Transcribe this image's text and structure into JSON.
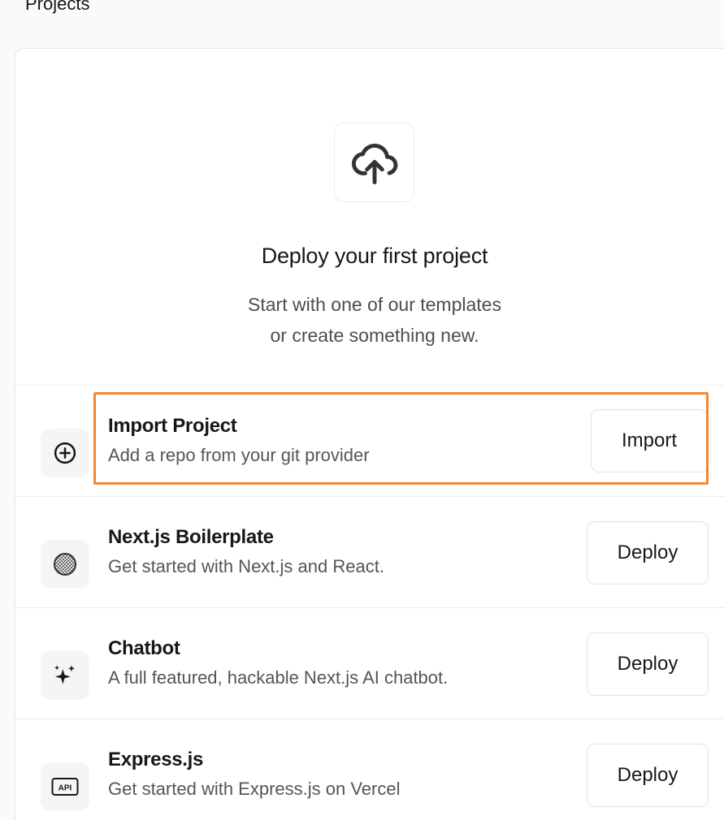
{
  "section_title": "Projects",
  "hero": {
    "icon": "cloud-upload-icon",
    "title": "Deploy your first project",
    "subtitle_line1": "Start with one of our templates",
    "subtitle_line2": "or create something new."
  },
  "import_row": {
    "icon": "plus-circle-icon",
    "title": "Import Project",
    "description": "Add a repo from your git provider",
    "button_label": "Import"
  },
  "templates": [
    {
      "icon": "nextjs-icon",
      "title": "Next.js Boilerplate",
      "description": "Get started with Next.js and React.",
      "button_label": "Deploy"
    },
    {
      "icon": "sparkles-icon",
      "title": "Chatbot",
      "description": "A full featured, hackable Next.js AI chatbot.",
      "button_label": "Deploy"
    },
    {
      "icon": "api-icon",
      "title": "Express.js",
      "description": "Get started with Express.js on Vercel",
      "button_label": "Deploy"
    }
  ],
  "colors": {
    "highlight_border": "#f5882e",
    "card_background": "#ffffff",
    "page_background": "#fafafa"
  }
}
